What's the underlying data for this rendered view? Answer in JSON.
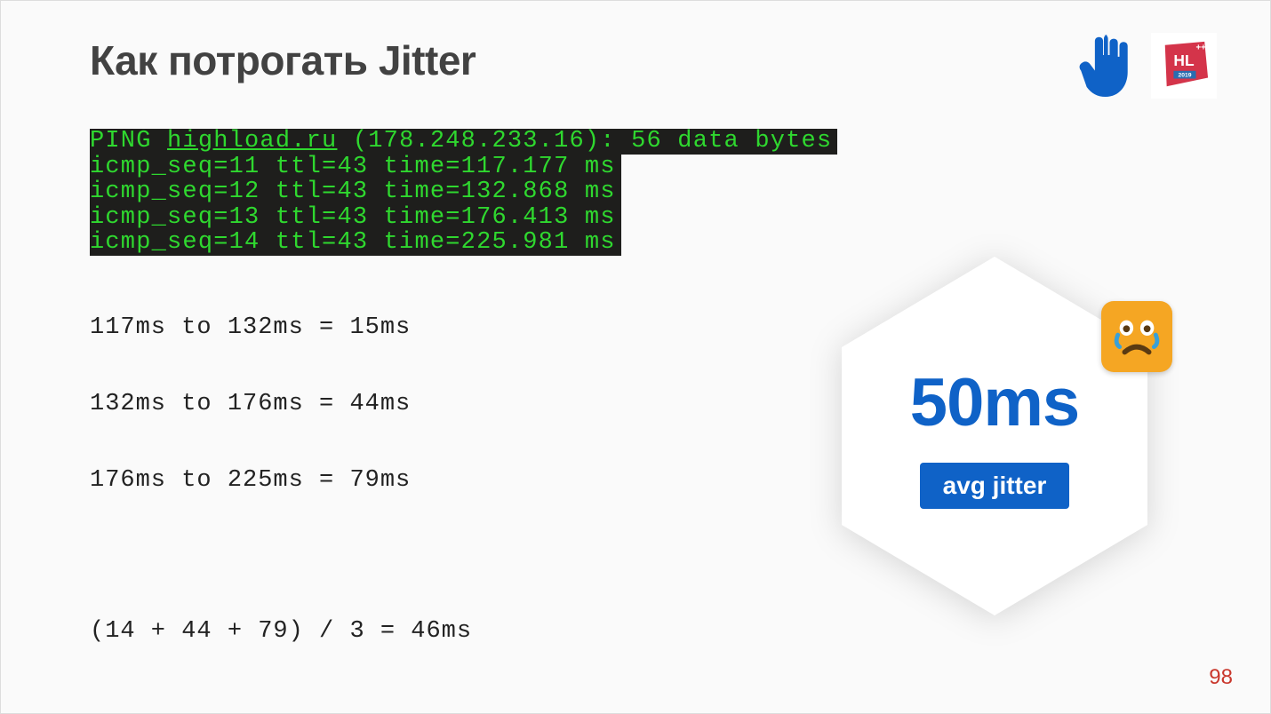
{
  "title": "Как потрогать Jitter",
  "terminal": {
    "ping_prefix": "PING ",
    "ping_host": "highload.ru",
    "ping_suffix": " (178.248.233.16): 56 data bytes",
    "lines": [
      "icmp_seq=11 ttl=43 time=117.177 ms",
      "icmp_seq=12 ttl=43 time=132.868 ms",
      "icmp_seq=13 ttl=43 time=176.413 ms",
      "icmp_seq=14 ttl=43 time=225.981 ms"
    ]
  },
  "calc": {
    "diffs": [
      "117ms to 132ms = 15ms",
      "132ms to 176ms = 44ms",
      "176ms to 225ms = 79ms"
    ],
    "avg": "(14 + 44 + 79) / 3 = 46ms"
  },
  "badge": {
    "value": "50ms",
    "label": "avg jitter"
  },
  "icons": {
    "hand": "hand-icon",
    "conference": "hl-2019-logo",
    "emoji": "sad-face-icon"
  },
  "page_number": "98"
}
